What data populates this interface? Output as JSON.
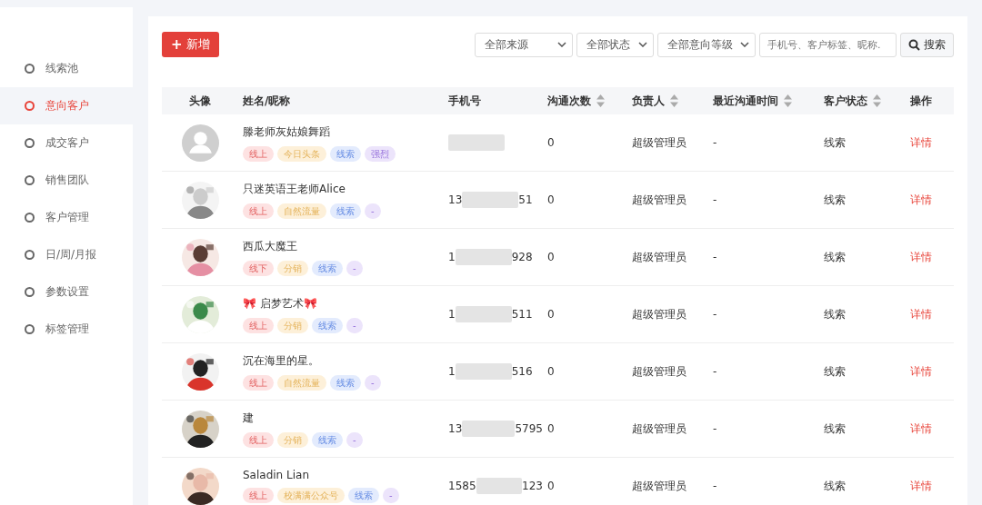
{
  "sidebar": {
    "items": [
      {
        "label": "线索池",
        "selected": false
      },
      {
        "label": "意向客户",
        "selected": true
      },
      {
        "label": "成交客户",
        "selected": false
      },
      {
        "label": "销售团队",
        "selected": false
      },
      {
        "label": "客户管理",
        "selected": false
      },
      {
        "label": "日/周/月报",
        "selected": false
      },
      {
        "label": "参数设置",
        "selected": false
      },
      {
        "label": "标签管理",
        "selected": false
      }
    ]
  },
  "toolbar": {
    "add_button": {
      "icon": "+",
      "label": "新增"
    },
    "filters": [
      "全部来源",
      "全部状态",
      "全部意向等级"
    ],
    "search": {
      "placeholder": "手机号、客户标签、昵称.",
      "button": "搜索"
    }
  },
  "table": {
    "columns": [
      {
        "label": "头像",
        "sortable": false
      },
      {
        "label": "姓名/昵称",
        "sortable": false
      },
      {
        "label": "手机号",
        "sortable": false
      },
      {
        "label": "沟通次数",
        "sortable": true
      },
      {
        "label": "负责人",
        "sortable": true
      },
      {
        "label": "最近沟通时间",
        "sortable": true
      },
      {
        "label": "客户状态",
        "sortable": true
      },
      {
        "label": "操作",
        "sortable": false
      }
    ],
    "rows": [
      {
        "avatar": {
          "kind": "default"
        },
        "name": "滕老师灰姑娘舞蹈",
        "tags": [
          {
            "label": "线上",
            "color": "#fde2e2"
          },
          {
            "label": "今日头条",
            "color": "#fdf0d9"
          },
          {
            "label": "线索",
            "color": "#e3ebfd"
          },
          {
            "label": "强烈",
            "color": "#ece4fb"
          }
        ],
        "count": "0",
        "owner": "超级管理员",
        "last_contact": "-",
        "status": "线索",
        "action": "详情"
      },
      {
        "name": "只迷英语王老师Alice",
        "tags": [
          {
            "label": "线上",
            "color": "#fde2e2"
          },
          {
            "label": "自然流量",
            "color": "#fdf0d9"
          },
          {
            "label": "线索",
            "color": "#e3ebfd"
          },
          {
            "label": "-",
            "color": "#ece4fb"
          }
        ],
        "phone_prefix": "13",
        "phone_suffix": "51",
        "count": "0",
        "owner": "超级管理员",
        "last_contact": "-",
        "status": "线索",
        "action": "详情"
      },
      {
        "name": "西瓜大魔王",
        "tags": [
          {
            "label": "线下",
            "color": "#fde2e2"
          },
          {
            "label": "分销",
            "color": "#fdf0d9"
          },
          {
            "label": "线索",
            "color": "#e3ebfd"
          },
          {
            "label": "-",
            "color": "#ece4fb"
          }
        ],
        "phone_prefix": "1",
        "phone_suffix": "928",
        "count": "0",
        "owner": "超级管理员",
        "last_contact": "-",
        "status": "线索",
        "action": "详情"
      },
      {
        "name": "🎀 启梦艺术🎀",
        "tags": [
          {
            "label": "线上",
            "color": "#fde2e2"
          },
          {
            "label": "分销",
            "color": "#fdf0d9"
          },
          {
            "label": "线索",
            "color": "#e3ebfd"
          },
          {
            "label": "-",
            "color": "#ece4fb"
          }
        ],
        "phone_prefix": "1",
        "phone_suffix": "511",
        "count": "0",
        "owner": "超级管理员",
        "last_contact": "-",
        "status": "线索",
        "action": "详情"
      },
      {
        "name": "沉在海里的星。",
        "tags": [
          {
            "label": "线上",
            "color": "#fde2e2"
          },
          {
            "label": "自然流量",
            "color": "#fdf0d9"
          },
          {
            "label": "线索",
            "color": "#e3ebfd"
          },
          {
            "label": "-",
            "color": "#ece4fb"
          }
        ],
        "phone_prefix": "1",
        "phone_suffix": "516",
        "count": "0",
        "owner": "超级管理员",
        "last_contact": "-",
        "status": "线索",
        "action": "详情"
      },
      {
        "name": "建",
        "tags": [
          {
            "label": "线上",
            "color": "#fde2e2"
          },
          {
            "label": "分销",
            "color": "#fdf0d9"
          },
          {
            "label": "线索",
            "color": "#e3ebfd"
          },
          {
            "label": "-",
            "color": "#ece4fb"
          }
        ],
        "phone_prefix": "13",
        "phone_suffix": "5795",
        "count": "0",
        "owner": "超级管理员",
        "last_contact": "-",
        "status": "线索",
        "action": "详情"
      },
      {
        "name": "Saladin Lian",
        "tags": [
          {
            "label": "线上",
            "color": "#fde2e2"
          },
          {
            "label": "校满满公众号",
            "color": "#fdf0d9"
          },
          {
            "label": "线索",
            "color": "#e3ebfd"
          },
          {
            "label": "-",
            "color": "#ece4fb"
          }
        ],
        "phone_prefix": "1585",
        "phone_suffix": "123",
        "count": "0",
        "owner": "超级管理员",
        "last_contact": "-",
        "status": "线索",
        "action": "详情"
      }
    ]
  }
}
